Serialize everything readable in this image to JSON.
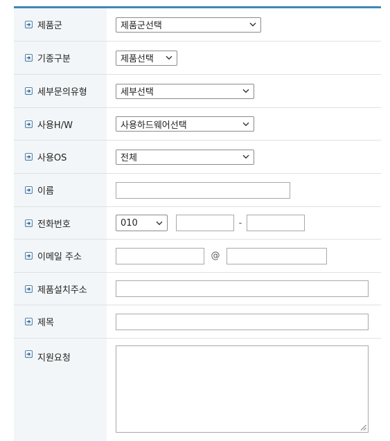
{
  "form": {
    "rows": {
      "product_group": {
        "label": "제품군",
        "value": "제품군선택"
      },
      "model_category": {
        "label": "기종구분",
        "value": "제품선택"
      },
      "inquiry_type": {
        "label": "세부문의유형",
        "value": "세부선택"
      },
      "hardware": {
        "label": "사용H/W",
        "value": "사용하드웨어선택"
      },
      "os": {
        "label": "사용OS",
        "value": "전체"
      },
      "name": {
        "label": "이름",
        "value": ""
      },
      "phone": {
        "label": "전화번호",
        "prefix": "010",
        "middle": "",
        "last": "",
        "separator": "-"
      },
      "email": {
        "label": "이메일 주소",
        "local": "",
        "at": "@",
        "domain": ""
      },
      "install_address": {
        "label": "제품설치주소",
        "value": ""
      },
      "subject": {
        "label": "제목",
        "value": ""
      },
      "request": {
        "label": "지원요청",
        "value": ""
      }
    }
  },
  "colors": {
    "header_line": "#3f87b7",
    "label_bg": "#f3f6f8",
    "row_border": "#e0e0e0",
    "icon_border": "#4d7fa9"
  },
  "icons": {
    "row_marker": "arrow-right-box-icon",
    "dropdown": "chevron-down-icon",
    "resize": "resize-grip-icon"
  }
}
